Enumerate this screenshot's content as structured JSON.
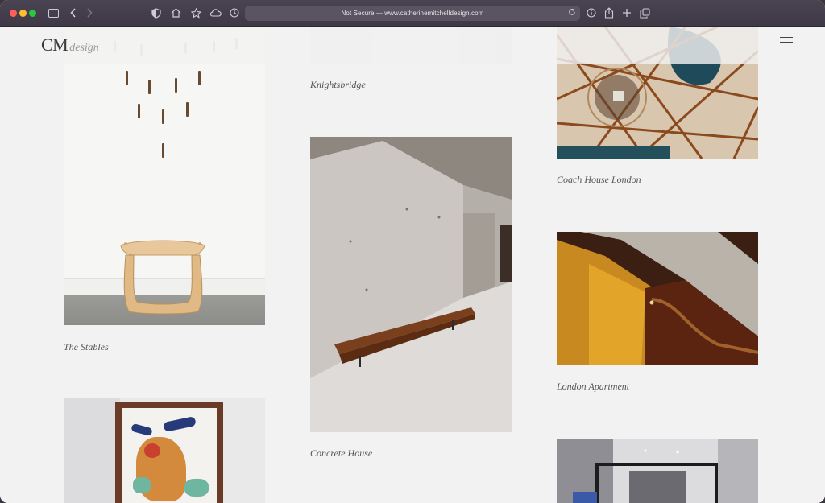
{
  "browser": {
    "address_text": "Not Secure — www.catherinemitchelldesign.com",
    "icons": [
      "sidebar-icon",
      "back-icon",
      "forward-icon",
      "privacy-icon",
      "home-icon",
      "star-icon",
      "cloud-icon",
      "history-icon",
      "reload-icon",
      "info-icon",
      "share-icon",
      "new-tab-icon",
      "tabs-icon"
    ]
  },
  "site": {
    "logo_main": "CM",
    "logo_sub": "design"
  },
  "projects": [
    {
      "caption": "The Stables"
    },
    {
      "caption": "Knightsbridge"
    },
    {
      "caption": "Concrete House"
    },
    {
      "caption": "Coach House London"
    },
    {
      "caption": "London Apartment"
    }
  ]
}
